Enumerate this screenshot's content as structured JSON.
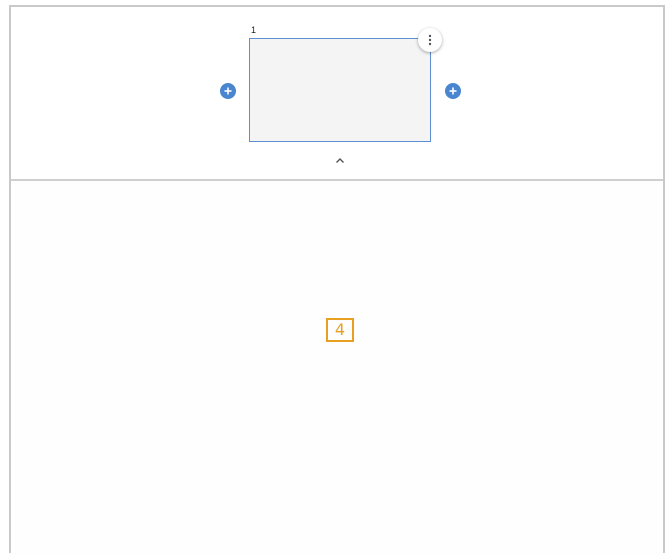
{
  "slide_panel": {
    "slide_number": "1",
    "icons": {
      "more": "more-vert-icon",
      "add_left": "add-circle-icon",
      "add_right": "add-circle-icon",
      "collapse": "chevron-up-icon"
    }
  },
  "main": {
    "marker_label": "4"
  },
  "colors": {
    "accent": "#4a86cf",
    "thumb_border": "#5b8fd1",
    "marker": "#e8a020"
  }
}
